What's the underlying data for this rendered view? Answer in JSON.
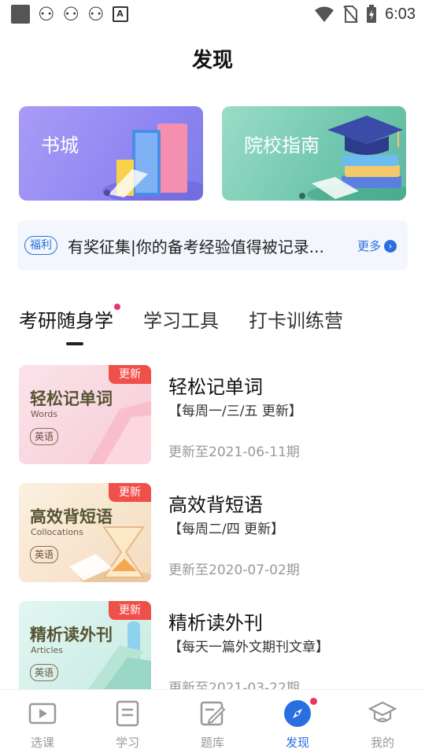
{
  "status_bar": {
    "time": "6:03",
    "icons": [
      "app-square-icon",
      "bug-icon",
      "bug-icon",
      "bug-icon",
      "font-a-icon",
      "wifi-icon",
      "no-sim-icon",
      "battery-charging-icon"
    ]
  },
  "header": {
    "title": "发现"
  },
  "banners": [
    {
      "label": "书城",
      "icon": "books-illustration"
    },
    {
      "label": "院校指南",
      "icon": "graduation-cap-illustration"
    }
  ],
  "notice": {
    "tag": "福利",
    "text": "有奖征集|你的备考经验值得被记录...",
    "more": "更多"
  },
  "tabs": [
    {
      "label": "考研随身学",
      "active": true,
      "dot": true
    },
    {
      "label": "学习工具"
    },
    {
      "label": "打卡训练营"
    }
  ],
  "courses": [
    {
      "thumb_title": "轻松记单词",
      "thumb_sub": "Words",
      "thumb_tag": "英语",
      "ribbon": "更新",
      "title": "轻松记单词",
      "schedule": "【每周一/三/五 更新】",
      "updated": "更新至2021-06-11期"
    },
    {
      "thumb_title": "高效背短语",
      "thumb_sub": "Collocations",
      "thumb_tag": "英语",
      "ribbon": "更新",
      "title": "高效背短语",
      "schedule": "【每周二/四 更新】",
      "updated": "更新至2020-07-02期"
    },
    {
      "thumb_title": "精析读外刊",
      "thumb_sub": "Articles",
      "thumb_tag": "英语",
      "ribbon": "更新",
      "title": "精析读外刊",
      "schedule": "【每天一篇外文期刊文章】",
      "updated": "更新至2021-03-22期"
    }
  ],
  "bottom_nav": [
    {
      "label": "选课",
      "icon": "play-video-icon"
    },
    {
      "label": "学习",
      "icon": "document-icon"
    },
    {
      "label": "题库",
      "icon": "edit-icon"
    },
    {
      "label": "发现",
      "icon": "compass-icon",
      "active": true,
      "dot": true
    },
    {
      "label": "我的",
      "icon": "graduate-cap-icon"
    }
  ],
  "colors": {
    "accent": "#2a6fe0",
    "badge": "#f0306b",
    "ribbon": "#f0504a"
  }
}
